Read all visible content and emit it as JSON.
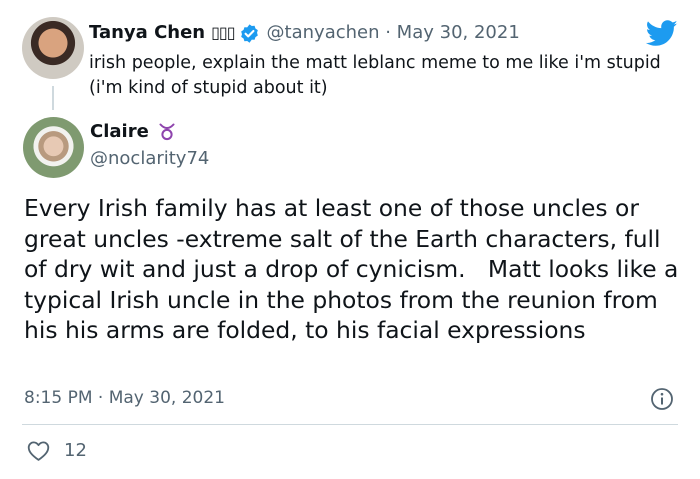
{
  "parent_tweet": {
    "author_name": "Tanya Chen",
    "name_glyphs": "▯▯▯",
    "handle_and_date": "@tanyachen · May 30, 2021",
    "text": "irish people, explain the matt leblanc meme to me like i'm stupid (i'm kind of stupid about it)",
    "verified": true
  },
  "reply_tweet": {
    "author_name": "Claire",
    "handle": "@noclarity74",
    "body": "Every Irish family has at least one of those uncles or great uncles -extreme salt of the Earth characters, full of dry wit and just a drop of cynicism.   Matt looks like a typical Irish uncle in the photos from the reunion from his his arms are folded, to his facial expressions",
    "timestamp": "8:15 PM · May 30, 2021",
    "like_count": "12"
  },
  "colors": {
    "twitter_blue": "#1d9bf0",
    "taurus_purple": "#8e44ad",
    "secondary_text": "#536471"
  },
  "icons": {
    "brand": "twitter-bird-icon",
    "verified": "verified-badge-icon",
    "zodiac": "taurus-emoji-icon",
    "info": "info-icon",
    "like": "heart-icon"
  }
}
